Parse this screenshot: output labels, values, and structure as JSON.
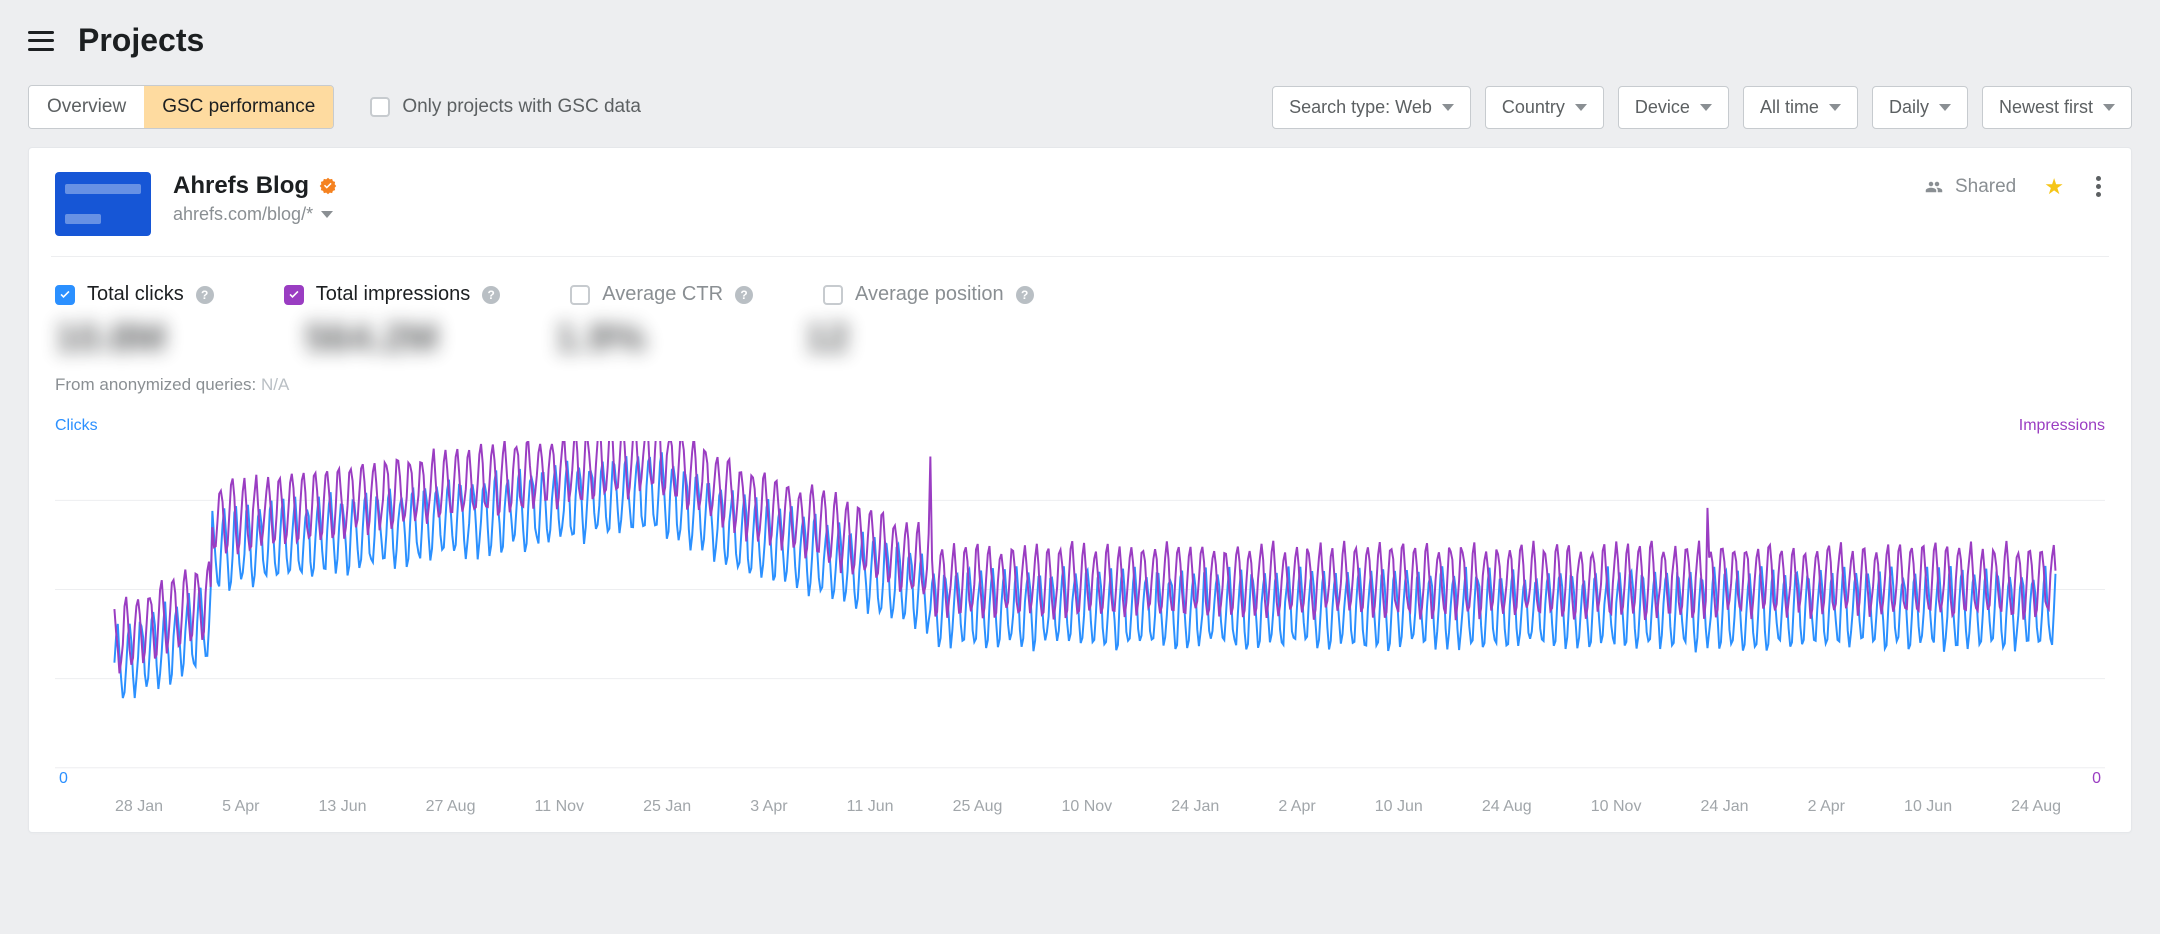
{
  "header": {
    "title": "Projects"
  },
  "tabs": {
    "overview": "Overview",
    "gsc": "GSC performance",
    "active": "gsc"
  },
  "only_gsc_label": "Only projects with GSC data",
  "dropdowns": {
    "search_type": "Search type: Web",
    "country": "Country",
    "device": "Device",
    "time": "All time",
    "granularity": "Daily",
    "sort": "Newest first"
  },
  "project": {
    "name": "Ahrefs Blog",
    "url": "ahrefs.com/blog/*",
    "shared_label": "Shared"
  },
  "metrics": {
    "total_clicks": {
      "label": "Total clicks",
      "checked": true,
      "value": "10.8M"
    },
    "total_impressions": {
      "label": "Total impressions",
      "checked": true,
      "value": "564.2M"
    },
    "avg_ctr": {
      "label": "Average CTR",
      "checked": false,
      "value": "1.9%"
    },
    "avg_position": {
      "label": "Average position",
      "checked": false,
      "value": "12"
    }
  },
  "anonymized": {
    "prefix": "From anonymized queries:",
    "value": "N/A"
  },
  "axis": {
    "left": "Clicks",
    "right": "Impressions",
    "zero": "0"
  },
  "chart_data": {
    "type": "line",
    "note": "values are relative/arbitrary; true numeric axis values are not labeled in screenshot",
    "x_ticks": [
      "28 Jan",
      "5 Apr",
      "13 Jun",
      "27 Aug",
      "11 Nov",
      "25 Jan",
      "3 Apr",
      "11 Jun",
      "25 Aug",
      "10 Nov",
      "24 Jan",
      "2 Apr",
      "10 Jun",
      "24 Aug",
      "10 Nov",
      "24 Jan",
      "2 Apr",
      "10 Jun",
      "24 Aug"
    ],
    "series": [
      {
        "name": "Clicks",
        "color": "#2b90ff"
      },
      {
        "name": "Impressions",
        "color": "#9a3dc2"
      }
    ],
    "y_zero": 0
  }
}
